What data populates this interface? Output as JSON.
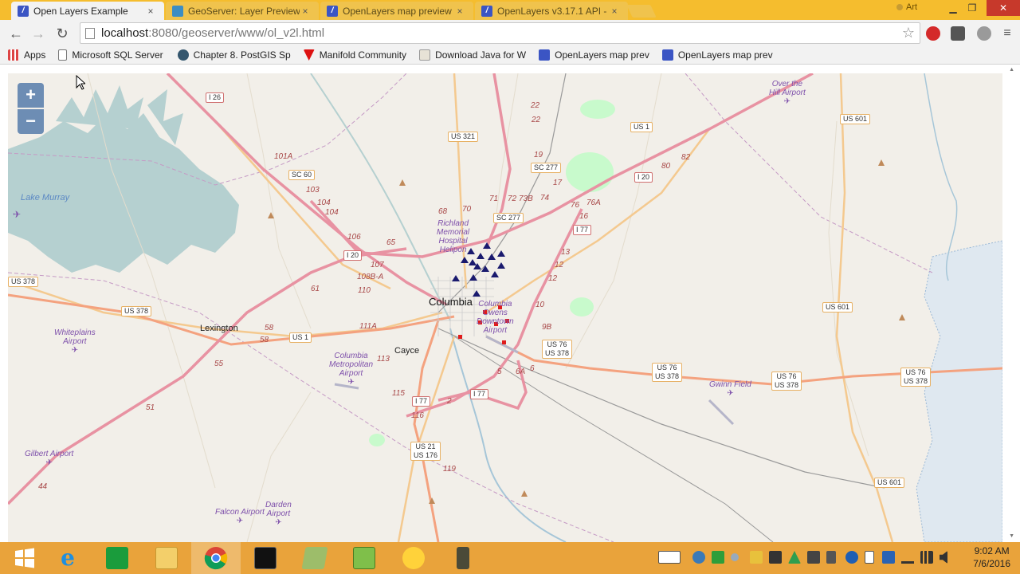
{
  "browser": {
    "tabs": [
      {
        "label": "Open Layers Example",
        "active": true,
        "favicon": "openlayers-favicon"
      },
      {
        "label": "GeoServer: Layer Preview",
        "active": false,
        "favicon": "geoserver-favicon"
      },
      {
        "label": "OpenLayers map preview",
        "active": false,
        "favicon": "openlayers-favicon"
      },
      {
        "label": "OpenLayers v3.17.1 API -",
        "active": false,
        "favicon": "openlayers-favicon"
      }
    ],
    "close_glyph": "×",
    "user_label": "Art",
    "url_host": "localhost",
    "url_path": ":8080/geoserver/www/ol_v2l.html",
    "bookmarks": [
      {
        "label": "Apps",
        "icon": "apps-grid-icon"
      },
      {
        "label": "Microsoft SQL Server",
        "icon": "page-icon"
      },
      {
        "label": "Chapter 8. PostGIS Sp",
        "icon": "postgis-icon"
      },
      {
        "label": "Manifold Community",
        "icon": "manifold-icon"
      },
      {
        "label": "Download Java for W",
        "icon": "java-icon"
      },
      {
        "label": "OpenLayers map prev",
        "icon": "openlayers-favicon"
      },
      {
        "label": "OpenLayers map prev",
        "icon": "openlayers-favicon"
      }
    ]
  },
  "map": {
    "zoom_in": "+",
    "zoom_out": "−",
    "places": {
      "columbia": "Columbia",
      "lexington": "Lexington",
      "cayce": "Cayce",
      "lake_murray": "Lake Murray"
    },
    "airports": {
      "over_the_hill": [
        "Over the",
        "Hill Airport"
      ],
      "richland": [
        "Richland",
        "Memorial",
        "Hospital",
        "Helipon"
      ],
      "owens": [
        "Columbia",
        "Owens",
        "Downtown",
        "Airport"
      ],
      "whiteplains": [
        "Whiteplains",
        "Airport"
      ],
      "metropolitan": [
        "Columbia",
        "Metropolitan",
        "Airport"
      ],
      "gwinn": [
        "Gwinn Field"
      ],
      "gilbert": [
        "Gilbert Airport"
      ],
      "falcon": [
        "Falcon Airport"
      ],
      "darden": [
        "Darden",
        "Airport"
      ]
    },
    "shields": {
      "i26": "I 26",
      "us321": "US 321",
      "us1_ne": "US 1",
      "us601_n": "US 601",
      "sc277": "SC 277",
      "i20_e": "I 20",
      "sc60": "SC 60",
      "sc277b": "SC 277",
      "i77_e": "I 77",
      "i20_w": "I 20",
      "us378_w": "US 378",
      "us378_far": "US 378",
      "us1_w": "US 1",
      "us601_e": "US 601",
      "us76_a": [
        "US 76",
        "US 378"
      ],
      "us76_b": [
        "US 76",
        "US 378"
      ],
      "us76_c": [
        "US 76",
        "US 378"
      ],
      "us76_d": [
        "US 76",
        "US 378"
      ],
      "i77_s": "I 77",
      "i77_s2": "I 77",
      "us21": [
        "US 21",
        "US 176"
      ],
      "us601_s": "US 601"
    },
    "exits": [
      {
        "t": "22"
      },
      {
        "t": "22"
      },
      {
        "t": "19"
      },
      {
        "t": "17"
      },
      {
        "t": "101A"
      },
      {
        "t": "103"
      },
      {
        "t": "104"
      },
      {
        "t": "104"
      },
      {
        "t": "106"
      },
      {
        "t": "65"
      },
      {
        "t": "68"
      },
      {
        "t": "70"
      },
      {
        "t": "71"
      },
      {
        "t": "72"
      },
      {
        "t": "73B"
      },
      {
        "t": "74"
      },
      {
        "t": "76"
      },
      {
        "t": "76A"
      },
      {
        "t": "16"
      },
      {
        "t": "80"
      },
      {
        "t": "82"
      },
      {
        "t": "13"
      },
      {
        "t": "12"
      },
      {
        "t": "12"
      },
      {
        "t": "10"
      },
      {
        "t": "9B"
      },
      {
        "t": "107"
      },
      {
        "t": "108B-A"
      },
      {
        "t": "110"
      },
      {
        "t": "111A"
      },
      {
        "t": "113"
      },
      {
        "t": "61"
      },
      {
        "t": "58"
      },
      {
        "t": "58"
      },
      {
        "t": "55"
      },
      {
        "t": "51"
      },
      {
        "t": "44"
      },
      {
        "t": "115"
      },
      {
        "t": "116"
      },
      {
        "t": "2"
      },
      {
        "t": "119"
      },
      {
        "t": "5"
      },
      {
        "t": "6A"
      },
      {
        "t": "6"
      }
    ],
    "colors": {
      "land": "#f2efe9",
      "water": "#b5d0d0",
      "motorway": "#e892a2",
      "trunk": "#f9b29c",
      "primary": "#fcd6a4",
      "minor": "#ffffff",
      "rail": "#999999",
      "border": "#ac46ac",
      "park": "#c8facc",
      "triangle_marker": "#1a1a6e",
      "square_marker": "#e01b1b"
    },
    "triangle_markers": 14,
    "square_markers": 7
  },
  "taskbar": {
    "apps": [
      {
        "name": "start-button",
        "icon": "windows-logo-icon"
      },
      {
        "name": "internet-explorer",
        "icon": "internet-explorer-icon"
      },
      {
        "name": "store",
        "icon": "store-icon"
      },
      {
        "name": "file-explorer",
        "icon": "folder-icon"
      },
      {
        "name": "chrome",
        "icon": "chrome-icon"
      },
      {
        "name": "command-prompt",
        "icon": "terminal-icon"
      },
      {
        "name": "manifold",
        "icon": "manifold-icon"
      },
      {
        "name": "notepad-plus",
        "icon": "notepad-icon"
      },
      {
        "name": "app-yellow",
        "icon": "arrows-icon"
      },
      {
        "name": "app-dark",
        "icon": "tool-icon"
      }
    ],
    "time": "9:02 AM",
    "date": "7/6/2016"
  }
}
